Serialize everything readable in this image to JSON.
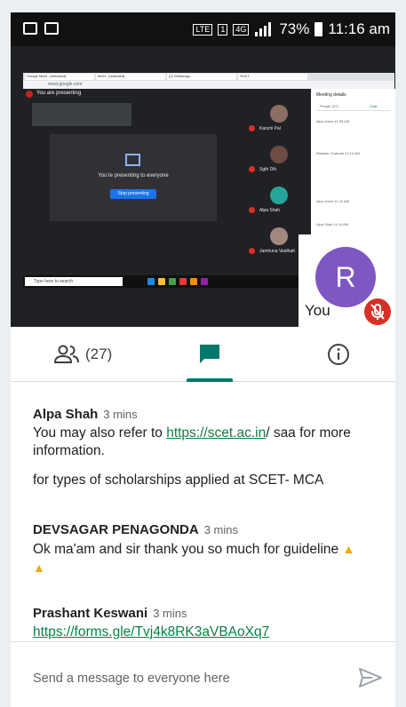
{
  "status_bar": {
    "network": "LTE",
    "sim": "1",
    "data": "4G",
    "battery": "73%",
    "time": "11:16 am"
  },
  "shared_screen": {
    "browser_tabs": [
      "Google Meet - [redacted]",
      "Meet - [redacted]",
      "(2) WhatsApp",
      "SCET"
    ],
    "address": "meet.google.com",
    "presenting_banner": "You are presenting",
    "present_message": "You're presenting to everyone",
    "stop_button": "Stop presenting",
    "participants": [
      {
        "name": "Kanchi Pal",
        "color": "#8d6e63"
      },
      {
        "name": "Sgth Dih",
        "color": "#6d4c41"
      },
      {
        "name": "Alpa Shah",
        "color": "#26a69a"
      },
      {
        "name": "Jamhuna Vaidhatt",
        "color": "#a1887f"
      }
    ],
    "panel_title": "Meeting details",
    "panel_tabs": [
      "People (27)",
      "Chat"
    ],
    "panel_messages": [
      "Alpa Vohra  11:05 AM",
      "Bhaskar Chandra  11:10 AM",
      "Alpa Vohra  11:11 AM",
      "Alpa Shah  11:14 AM"
    ],
    "taskbar_search": "Type here to search"
  },
  "self_tile": {
    "initial": "R",
    "name": "You",
    "avatar_color": "#7e57c2"
  },
  "tabs": {
    "people_count": "(27)"
  },
  "messages": [
    {
      "sender": "Alpa Shah",
      "time": "3 mins",
      "lines": [
        {
          "before": "You may also refer to ",
          "link": "https://scet.ac.in",
          "after": "/ saa for more information."
        },
        {
          "text": "for types of scholarships applied at SCET- MCA"
        }
      ]
    },
    {
      "sender": "DEVSAGAR PENAGONDA",
      "time": "3 mins",
      "text": "Ok ma'am and sir thank you so much for guideline"
    },
    {
      "sender": "Prashant Keswani",
      "time": "3 mins",
      "link": "https://forms.gle/Tvj4k8RK3aVBAoXq7"
    }
  ],
  "composer": {
    "placeholder": "Send a message to everyone here"
  },
  "colors": {
    "accent_teal": "#00796b",
    "link_green": "#0b8043",
    "mute_red": "#d93025"
  }
}
